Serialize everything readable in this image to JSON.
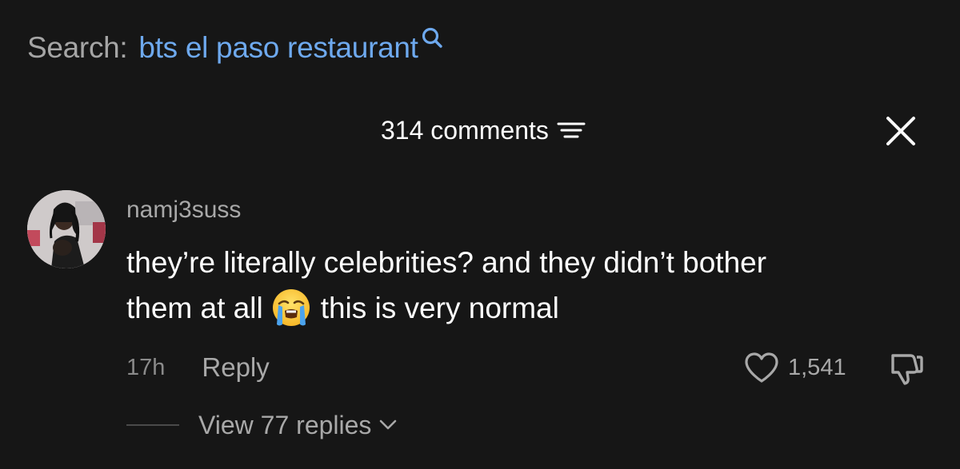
{
  "search": {
    "label": "Search:",
    "query": "bts el paso restaurant",
    "icon": "search-icon"
  },
  "comments_panel": {
    "title": "314 comments",
    "sort_icon": "sort-icon",
    "close_icon": "close-icon"
  },
  "comment": {
    "username": "namj3suss",
    "text_line1": "they’re literally celebrities? and they didn’t bother",
    "text_line2_before": "them at all",
    "emoji": "crying-face-emoji",
    "text_line2_after": "this is very normal",
    "timestamp": "17h",
    "reply_label": "Reply",
    "like_count": "1,541",
    "like_icon": "heart-icon",
    "dislike_icon": "thumbs-down-icon",
    "view_replies_label": "View 77 replies"
  },
  "colors": {
    "background": "#161616",
    "search_query": "#6ea9ee",
    "muted_text": "#a8a8a8"
  }
}
